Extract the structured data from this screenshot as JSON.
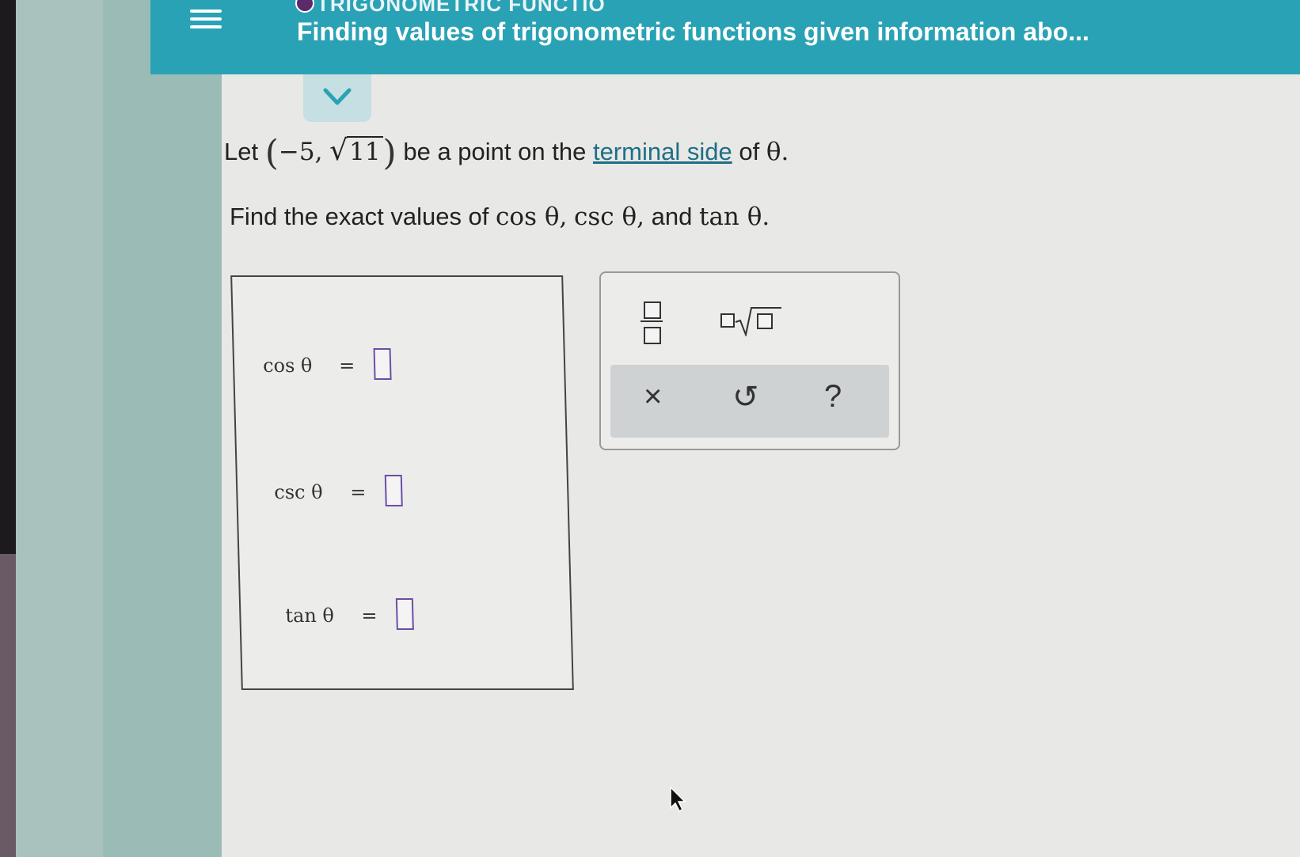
{
  "header": {
    "title": "Finding values of trigonometric functions given information abo...",
    "top_cut_text": "TRIGONOMETRIC FUNCTIO"
  },
  "problem": {
    "let_prefix": "Let",
    "point_x": "−5,",
    "point_y_radicand": "11",
    "middle_text": "be a point on the",
    "link_text": "terminal side",
    "suffix_text": "of",
    "theta": "θ.",
    "find_prefix": "Find the exact values of",
    "cos_label": "cos θ,",
    "csc_label": "csc θ,",
    "and_text": "and",
    "tan_label": "tan θ."
  },
  "answers": [
    {
      "label": "cos θ",
      "equals": "="
    },
    {
      "label": "csc θ",
      "equals": "="
    },
    {
      "label": "tan θ",
      "equals": "="
    }
  ],
  "keypad": {
    "clear_icon": "×",
    "undo_icon": "↺",
    "help_icon": "?"
  }
}
